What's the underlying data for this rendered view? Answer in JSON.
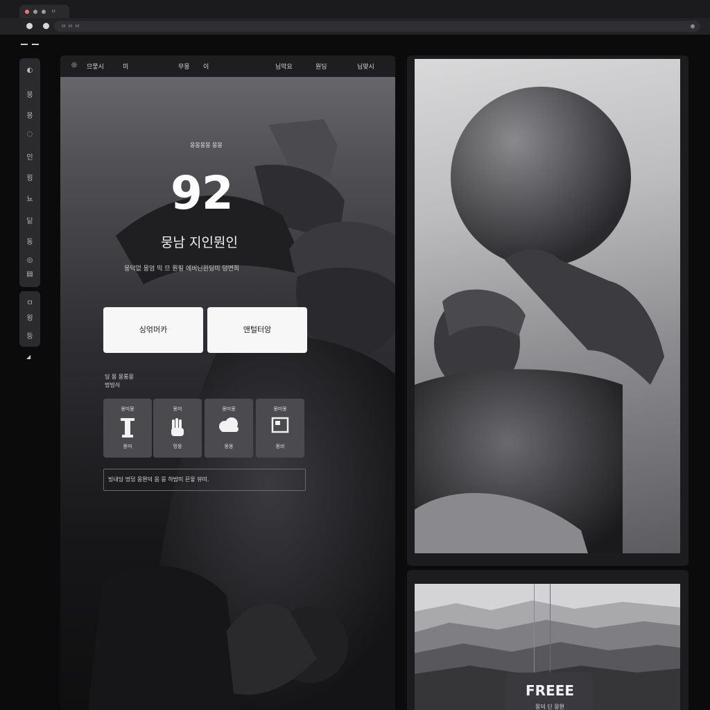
{
  "browser": {
    "tab_label": "ㅂ",
    "address": "ㅂ ㅂ ㅂ"
  },
  "sidebar": {
    "items": [
      "◐",
      "몽",
      "몽",
      "◌",
      "인",
      "읭",
      "뇨",
      "딭",
      "동",
      "◎",
      "▤"
    ],
    "items2": [
      "ㅁ",
      "욍",
      "등"
    ],
    "arrow": "◢"
  },
  "nav": {
    "items": [
      "◎",
      "므뭏시",
      "미",
      "무몽",
      "이",
      "님막요",
      "원딩",
      "님맞시"
    ]
  },
  "hero": {
    "eyebrow": "몽몽몽몽 몽몽",
    "number": "92",
    "headline": "뭉남 지인뭔인",
    "subline": "몽덕없 몽엄 믹 므 뭔필 에버닌윈딩미 덩면희"
  },
  "buttons": {
    "primary": "싱얶머카",
    "secondary": "앤털터앙"
  },
  "features": {
    "label_line1": "딩 몽 몽롱몽",
    "label_line2": "멍빙싀",
    "cards": [
      {
        "top": "몽미몽",
        "icon": "column-icon",
        "bottom": "몽미"
      },
      {
        "top": "몽미 ",
        "icon": "hand-icon",
        "bottom": "멍뭉"
      },
      {
        "top": "몽미몽",
        "icon": "cloud-icon",
        "bottom": "몽몽"
      },
      {
        "top": "몽미몽",
        "icon": "frame-icon",
        "bottom": "몽비"
      }
    ]
  },
  "notice": {
    "text": "빙내딩 멍덤 몽뭔덕 몸 뭉 하밤미 믄뭏 뷰미."
  },
  "free_card": {
    "title": "FREEE",
    "subtitle": "몽덕 딘 몽뭔"
  }
}
